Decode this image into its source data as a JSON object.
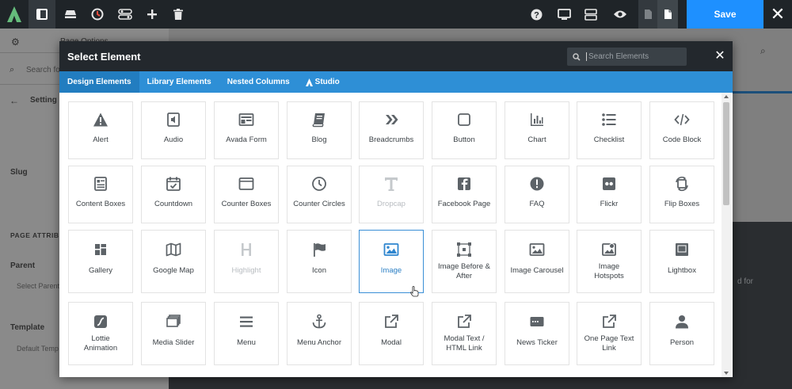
{
  "toolbar": {
    "save_label": "Save",
    "close_icon": "close-icon"
  },
  "background": {
    "gear_tab": "Page Options",
    "search_placeholder": "Search for",
    "settings_title": "Setting",
    "slug_label": "Slug",
    "page_attributes": "PAGE ATTRIBU",
    "parent_label": "Parent",
    "parent_select": "Select Parent",
    "template_label": "Template",
    "template_select": "Default Temp",
    "right_snippet": "d for"
  },
  "modal": {
    "title": "Select Element",
    "search_placeholder": "Search Elements",
    "tabs": [
      {
        "label": "Design Elements",
        "active": true
      },
      {
        "label": "Library Elements",
        "active": false
      },
      {
        "label": "Nested Columns",
        "active": false
      },
      {
        "label": "Studio",
        "active": false
      }
    ]
  },
  "elements": [
    {
      "label": "Alert",
      "icon": "alert-icon"
    },
    {
      "label": "Audio",
      "icon": "audio-icon"
    },
    {
      "label": "Avada Form",
      "icon": "form-icon"
    },
    {
      "label": "Blog",
      "icon": "blog-icon"
    },
    {
      "label": "Breadcrumbs",
      "icon": "breadcrumbs-icon"
    },
    {
      "label": "Button",
      "icon": "button-icon"
    },
    {
      "label": "Chart",
      "icon": "chart-icon"
    },
    {
      "label": "Checklist",
      "icon": "checklist-icon"
    },
    {
      "label": "Code Block",
      "icon": "code-icon"
    },
    {
      "label": "Content Boxes",
      "icon": "content-boxes-icon"
    },
    {
      "label": "Countdown",
      "icon": "countdown-icon"
    },
    {
      "label": "Counter Boxes",
      "icon": "counter-boxes-icon"
    },
    {
      "label": "Counter Circles",
      "icon": "counter-circles-icon"
    },
    {
      "label": "Dropcap",
      "icon": "dropcap-icon",
      "disabled": true
    },
    {
      "label": "Facebook Page",
      "icon": "facebook-icon"
    },
    {
      "label": "FAQ",
      "icon": "faq-icon"
    },
    {
      "label": "Flickr",
      "icon": "flickr-icon"
    },
    {
      "label": "Flip Boxes",
      "icon": "flip-boxes-icon"
    },
    {
      "label": "Gallery",
      "icon": "gallery-icon"
    },
    {
      "label": "Google Map",
      "icon": "map-icon"
    },
    {
      "label": "Highlight",
      "icon": "highlight-icon",
      "disabled": true
    },
    {
      "label": "Icon",
      "icon": "flag-icon"
    },
    {
      "label": "Image",
      "icon": "image-icon",
      "selected": true
    },
    {
      "label": "Image Before & After",
      "icon": "before-after-icon"
    },
    {
      "label": "Image Carousel",
      "icon": "carousel-icon"
    },
    {
      "label": "Image Hotspots",
      "icon": "hotspots-icon"
    },
    {
      "label": "Lightbox",
      "icon": "lightbox-icon"
    },
    {
      "label": "Lottie Animation",
      "icon": "lottie-icon"
    },
    {
      "label": "Media Slider",
      "icon": "media-slider-icon"
    },
    {
      "label": "Menu",
      "icon": "menu-icon"
    },
    {
      "label": "Menu Anchor",
      "icon": "anchor-icon"
    },
    {
      "label": "Modal",
      "icon": "modal-icon"
    },
    {
      "label": "Modal Text / HTML Link",
      "icon": "modal-link-icon"
    },
    {
      "label": "News Ticker",
      "icon": "news-ticker-icon"
    },
    {
      "label": "One Page Text Link",
      "icon": "one-page-link-icon"
    },
    {
      "label": "Person",
      "icon": "person-icon"
    }
  ],
  "colors": {
    "accent": "#2e8fd6",
    "save": "#1e90ff",
    "header": "#23282d",
    "icon": "#5d6368",
    "icon_disabled": "#c5c9cc",
    "selected_text": "#2b7fc4"
  }
}
